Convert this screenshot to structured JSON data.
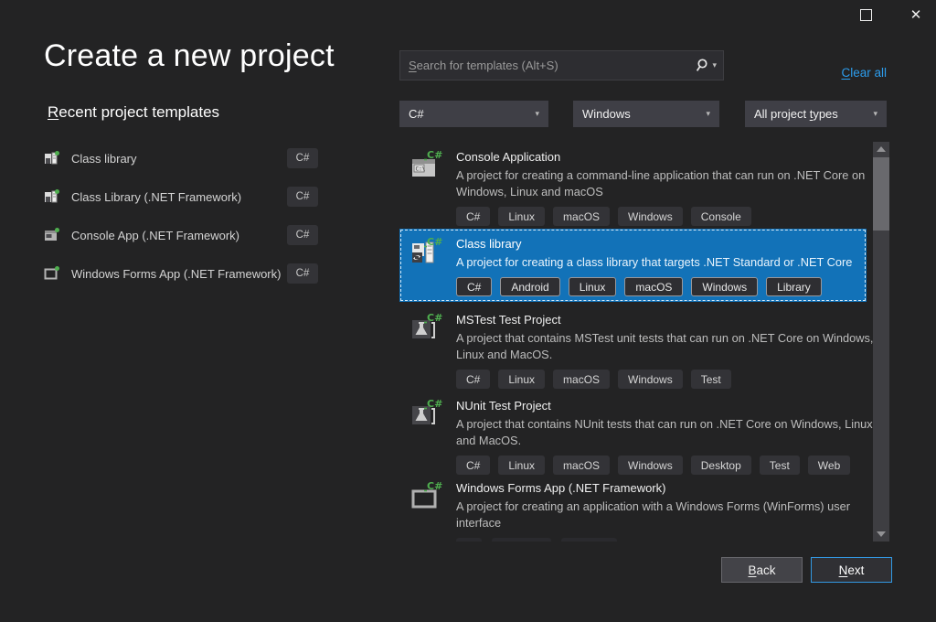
{
  "window": {
    "title": "Create a new project"
  },
  "search": {
    "placeholder_key": "S",
    "placeholder_rest": "earch for templates (Alt+S)"
  },
  "clear_all": {
    "key": "C",
    "rest": "lear all"
  },
  "filters": {
    "language": "C#",
    "platform": "Windows",
    "project_type_pre": "All project ",
    "project_type_key": "t",
    "project_type_rest": "ypes"
  },
  "recent": {
    "heading_key": "R",
    "heading_rest": "ecent project templates",
    "items": [
      {
        "label": "Class library",
        "badge": "C#",
        "icon": "class-library-icon"
      },
      {
        "label": "Class Library (.NET Framework)",
        "badge": "C#",
        "icon": "class-library-icon"
      },
      {
        "label": "Console App (.NET Framework)",
        "badge": "C#",
        "icon": "console-app-icon"
      },
      {
        "label": "Windows Forms App (.NET Framework)",
        "badge": "C#",
        "icon": "winforms-icon"
      }
    ]
  },
  "templates": [
    {
      "name": "Console Application",
      "description": "A project for creating a command-line application that can run on .NET Core on Windows, Linux and macOS",
      "tags": [
        "C#",
        "Linux",
        "macOS",
        "Windows",
        "Console"
      ],
      "selected": false,
      "icon": "console-app-icon"
    },
    {
      "name": "Class library",
      "description": "A project for creating a class library that targets .NET Standard or .NET Core",
      "tags": [
        "C#",
        "Android",
        "Linux",
        "macOS",
        "Windows",
        "Library"
      ],
      "selected": true,
      "icon": "class-library-icon"
    },
    {
      "name": "MSTest Test Project",
      "description": "A project that contains MSTest unit tests that can run on .NET Core on Windows, Linux and MacOS.",
      "tags": [
        "C#",
        "Linux",
        "macOS",
        "Windows",
        "Test"
      ],
      "selected": false,
      "icon": "test-flask-icon"
    },
    {
      "name": "NUnit Test Project",
      "description": "A project that contains NUnit tests that can run on .NET Core on Windows, Linux and MacOS.",
      "tags": [
        "C#",
        "Linux",
        "macOS",
        "Windows",
        "Desktop",
        "Test",
        "Web"
      ],
      "selected": false,
      "icon": "test-flask-icon"
    },
    {
      "name": "Windows Forms App (.NET Framework)",
      "description": "A project for creating an application with a Windows Forms (WinForms) user interface",
      "tags": [],
      "selected": false,
      "icon": "winforms-icon"
    }
  ],
  "footer": {
    "back_key": "B",
    "back_rest": "ack",
    "next_key": "N",
    "next_rest": "ext"
  },
  "colors": {
    "selection_blue": "#1272b8",
    "link_blue": "#2c9cec",
    "next_button_border": "#3399e3",
    "tag_background": "#333337",
    "icon_green": "#4fae4f",
    "background": "#232324"
  }
}
